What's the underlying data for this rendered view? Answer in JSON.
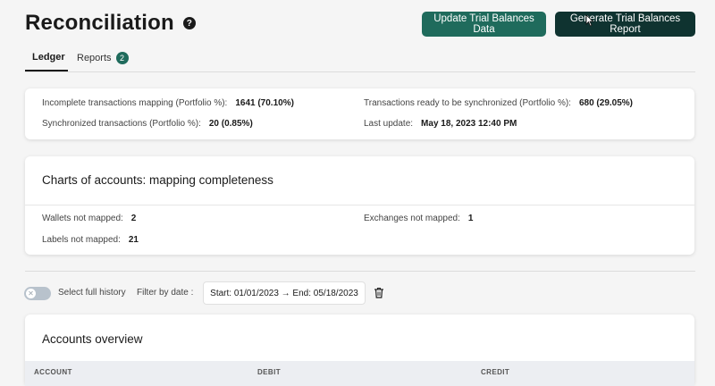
{
  "header": {
    "title": "Reconciliation",
    "help_glyph": "?"
  },
  "buttons": {
    "update_label": "Update Trial Balances Data",
    "generate_label": "Generate Trial Balances Report"
  },
  "tabs": [
    {
      "label": "Ledger",
      "active": true
    },
    {
      "label": "Reports",
      "badge": "2"
    }
  ],
  "summary": {
    "incomplete_label": "Incomplete transactions mapping (Portfolio %):",
    "incomplete_value": "1641 (70.10%)",
    "ready_label": "Transactions ready to be synchronized (Portfolio %):",
    "ready_value": "680 (29.05%)",
    "synced_label": "Synchronized transactions (Portfolio %):",
    "synced_value": "20 (0.85%)",
    "last_update_label": "Last update:",
    "last_update_value": "May 18, 2023 12:40 PM"
  },
  "mapping": {
    "title": "Charts of accounts: mapping completeness",
    "wallets_label": "Wallets not mapped:",
    "wallets_value": "2",
    "exchanges_label": "Exchanges not mapped:",
    "exchanges_value": "1",
    "labels_label": "Labels not mapped:",
    "labels_value": "21"
  },
  "filters": {
    "full_history_label": "Select full history",
    "filter_label": "Filter by date :",
    "date_range": "Start: 01/01/2023 → End: 05/18/2023",
    "toggle_on": false
  },
  "accounts": {
    "title": "Accounts overview",
    "columns": [
      "ACCOUNT",
      "DEBIT",
      "CREDIT"
    ]
  },
  "colors": {
    "accent": "#1f6b5c",
    "dark_button": "#0f3330"
  }
}
